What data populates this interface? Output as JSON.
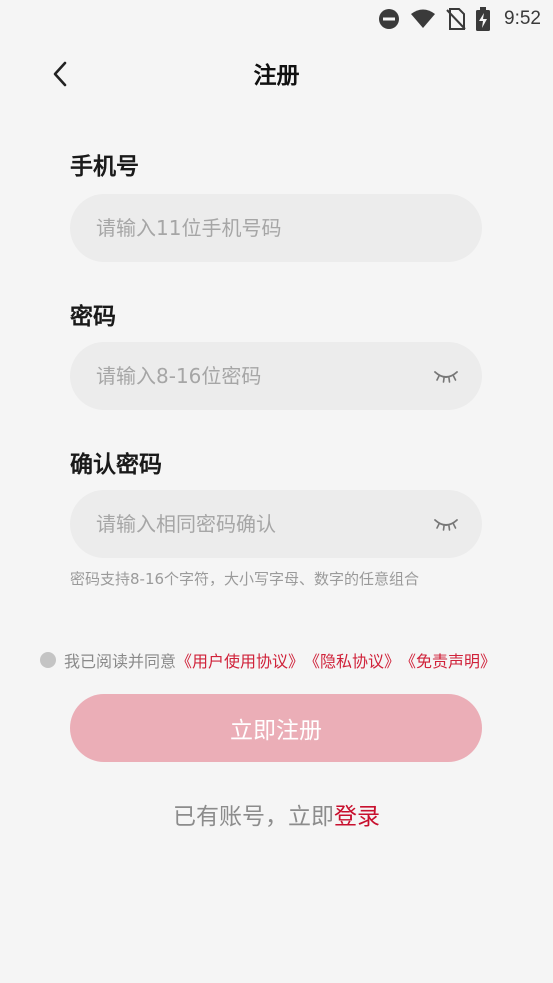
{
  "status_bar": {
    "time": "9:52",
    "icons": [
      "do-not-disturb-icon",
      "wifi-icon",
      "no-sim-icon",
      "battery-charging-icon"
    ]
  },
  "header": {
    "title": "注册",
    "back_icon": "chevron-left-icon"
  },
  "form": {
    "phone": {
      "label": "手机号",
      "placeholder": "请输入11位手机号码",
      "value": ""
    },
    "password": {
      "label": "密码",
      "placeholder": "请输入8-16位密码",
      "value": "",
      "toggle_icon": "eye-closed-icon"
    },
    "confirm_password": {
      "label": "确认密码",
      "placeholder": "请输入相同密码确认",
      "value": "",
      "toggle_icon": "eye-closed-icon"
    },
    "hint": "密码支持8-16个字符，大小写字母、数字的任意组合"
  },
  "agreement": {
    "checked": false,
    "prefix": "我已阅读并同意",
    "links": [
      "《用户使用协议》",
      "《隐私协议》",
      "《免责声明》"
    ]
  },
  "submit": {
    "label": "立即注册"
  },
  "login": {
    "prompt": "已有账号，立即",
    "link": "登录"
  },
  "colors": {
    "background": "#f5f5f5",
    "accent": "#c8102e",
    "button_disabled": "#ebaeb7",
    "field_bg": "#ececec"
  }
}
